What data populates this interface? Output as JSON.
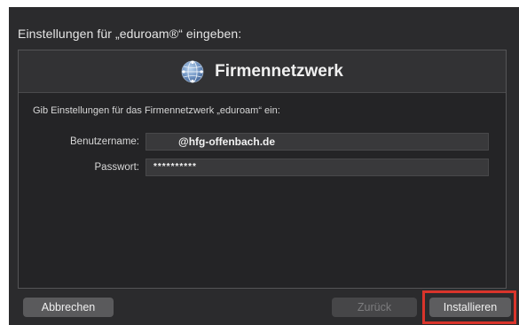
{
  "dialog": {
    "title": "Einstellungen für „eduroam®“ eingeben:"
  },
  "panel": {
    "icon": "network-globe-icon",
    "title": "Firmennetzwerk",
    "instruction": "Gib Einstellungen für das Firmennetzwerk „eduroam“ ein:"
  },
  "form": {
    "username_label": "Benutzername:",
    "username_value": "@hfg-offenbach.de",
    "password_label": "Passwort:",
    "password_value": "**********"
  },
  "buttons": {
    "cancel": "Abbrechen",
    "back": "Zurück",
    "install": "Installieren"
  },
  "colors": {
    "highlight": "#d9342b",
    "background": "#2b2b2d"
  }
}
